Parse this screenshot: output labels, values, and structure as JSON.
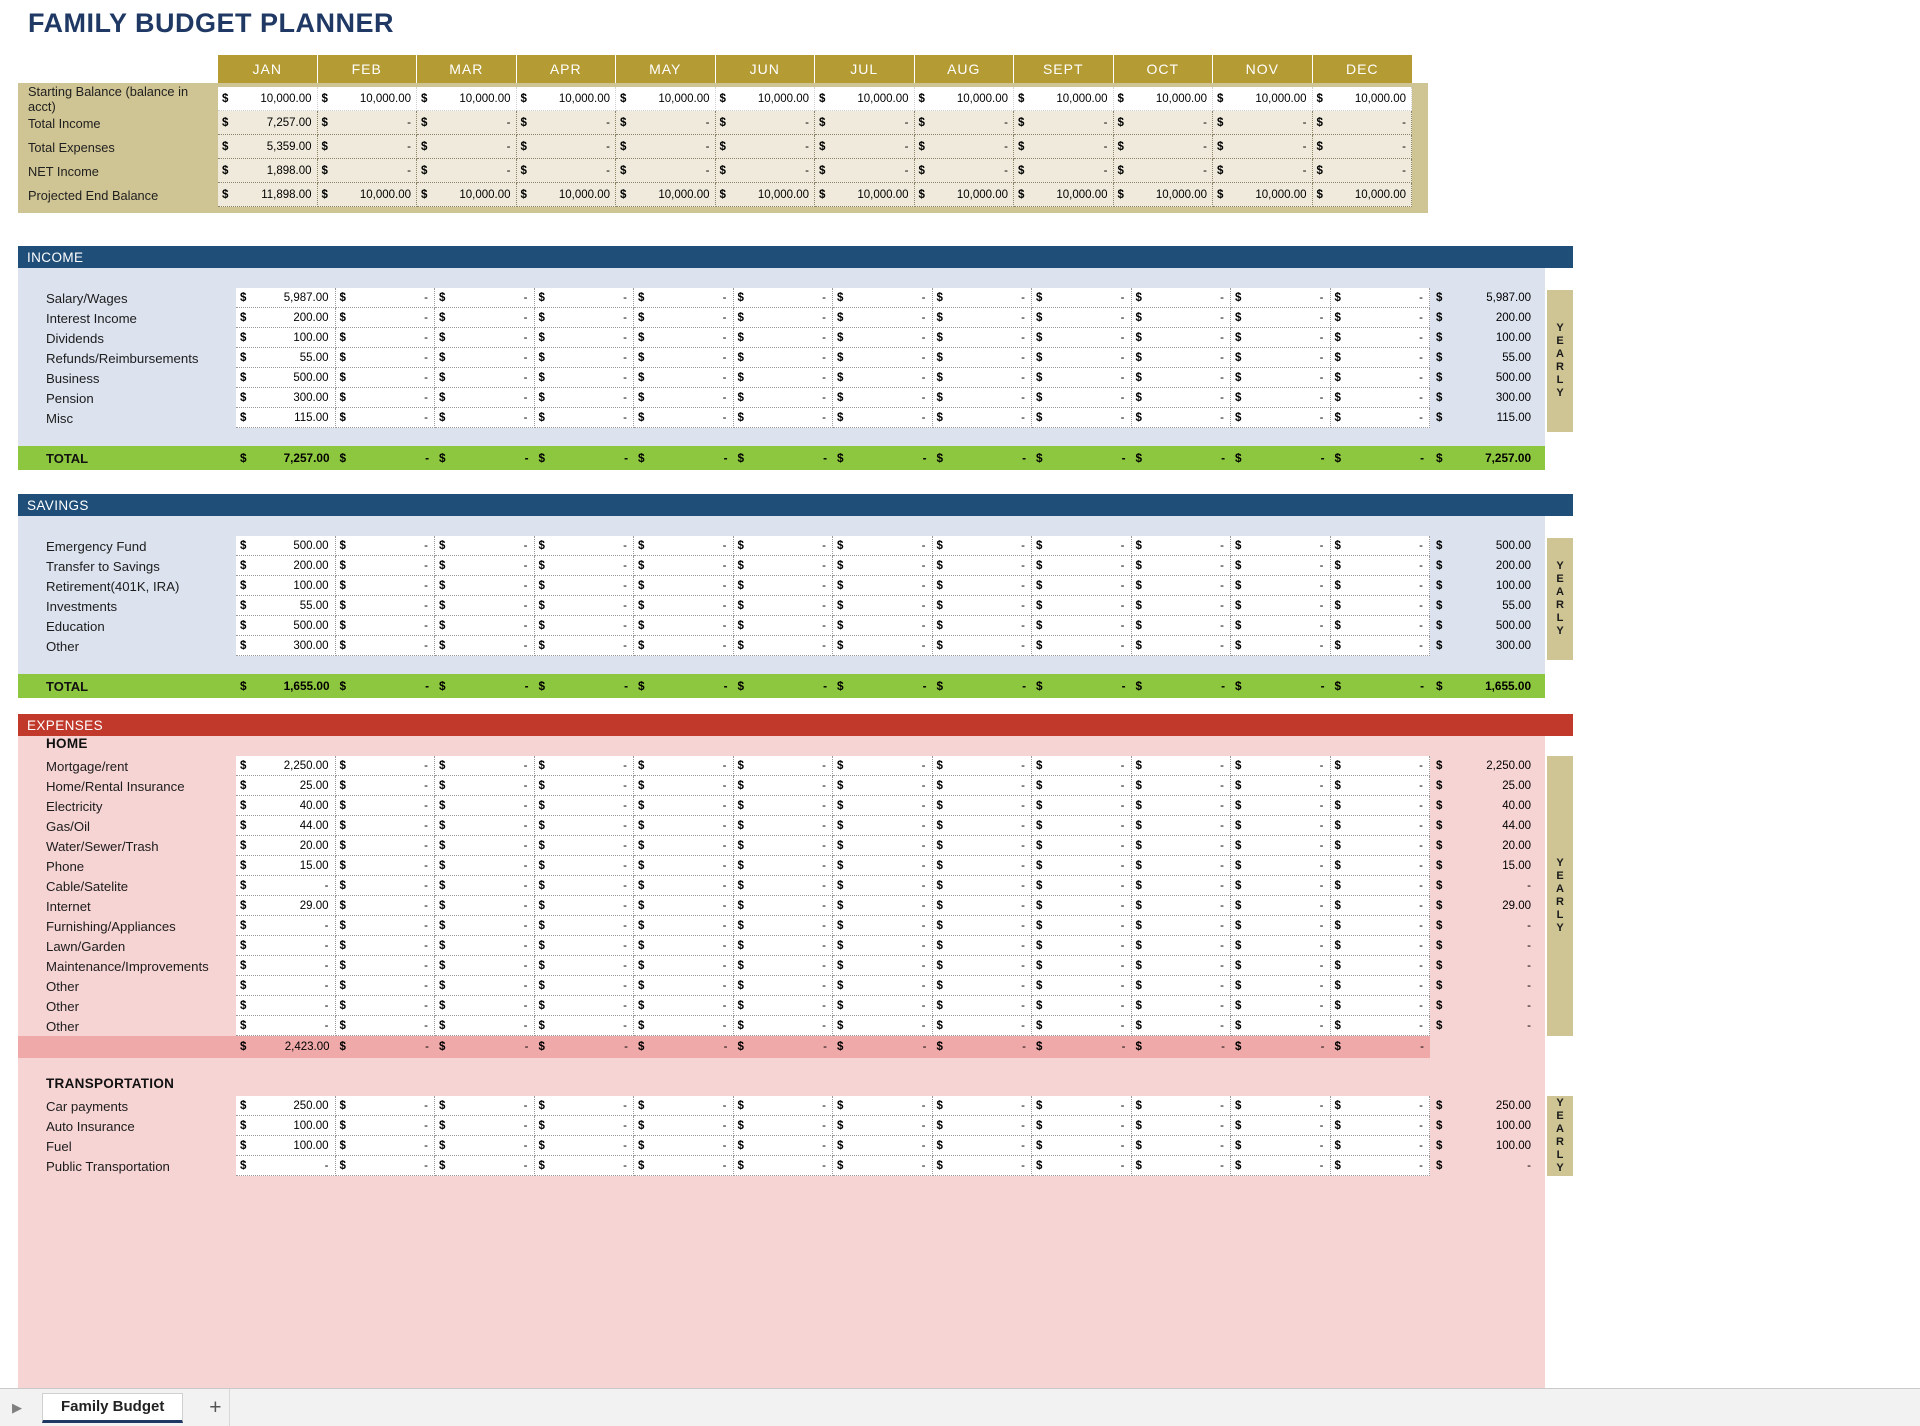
{
  "title": "FAMILY BUDGET PLANNER",
  "months": [
    "JAN",
    "FEB",
    "MAR",
    "APR",
    "MAY",
    "JUN",
    "JUL",
    "AUG",
    "SEPT",
    "OCT",
    "NOV",
    "DEC"
  ],
  "currency_symbol": "$",
  "blank_value": "-",
  "yearly_label": "YEARLY",
  "colors": {
    "title": "#1F3864",
    "month_header": "#B49B33",
    "summary_band": "#CFC493",
    "section_blue": "#1F4E79",
    "section_red": "#C0392B",
    "panel_blue": "#DCE3EF",
    "panel_red": "#F7D4D4",
    "total_green": "#8DC63F",
    "subtotal_pink": "#EFA9A9"
  },
  "summary": {
    "rows": [
      {
        "label": "Starting Balance (balance in acct)",
        "values": [
          "10,000.00",
          "10,000.00",
          "10,000.00",
          "10,000.00",
          "10,000.00",
          "10,000.00",
          "10,000.00",
          "10,000.00",
          "10,000.00",
          "10,000.00",
          "10,000.00",
          "10,000.00"
        ]
      },
      {
        "label": "Total Income",
        "values": [
          "7,257.00",
          "-",
          "-",
          "-",
          "-",
          "-",
          "-",
          "-",
          "-",
          "-",
          "-",
          "-"
        ]
      },
      {
        "label": "Total Expenses",
        "values": [
          "5,359.00",
          "-",
          "-",
          "-",
          "-",
          "-",
          "-",
          "-",
          "-",
          "-",
          "-",
          "-"
        ]
      },
      {
        "label": "NET Income",
        "values": [
          "1,898.00",
          "-",
          "-",
          "-",
          "-",
          "-",
          "-",
          "-",
          "-",
          "-",
          "-",
          "-"
        ]
      },
      {
        "label": "Projected End Balance",
        "values": [
          "11,898.00",
          "10,000.00",
          "10,000.00",
          "10,000.00",
          "10,000.00",
          "10,000.00",
          "10,000.00",
          "10,000.00",
          "10,000.00",
          "10,000.00",
          "10,000.00",
          "10,000.00"
        ]
      }
    ]
  },
  "income": {
    "section_label": "INCOME",
    "total_label": "TOTAL",
    "rows": [
      {
        "label": "Salary/Wages",
        "values": [
          "5,987.00",
          "-",
          "-",
          "-",
          "-",
          "-",
          "-",
          "-",
          "-",
          "-",
          "-",
          "-"
        ],
        "yearly": "5,987.00"
      },
      {
        "label": "Interest Income",
        "values": [
          "200.00",
          "-",
          "-",
          "-",
          "-",
          "-",
          "-",
          "-",
          "-",
          "-",
          "-",
          "-"
        ],
        "yearly": "200.00"
      },
      {
        "label": "Dividends",
        "values": [
          "100.00",
          "-",
          "-",
          "-",
          "-",
          "-",
          "-",
          "-",
          "-",
          "-",
          "-",
          "-"
        ],
        "yearly": "100.00"
      },
      {
        "label": "Refunds/Reimbursements",
        "values": [
          "55.00",
          "-",
          "-",
          "-",
          "-",
          "-",
          "-",
          "-",
          "-",
          "-",
          "-",
          "-"
        ],
        "yearly": "55.00"
      },
      {
        "label": "Business",
        "values": [
          "500.00",
          "-",
          "-",
          "-",
          "-",
          "-",
          "-",
          "-",
          "-",
          "-",
          "-",
          "-"
        ],
        "yearly": "500.00"
      },
      {
        "label": "Pension",
        "values": [
          "300.00",
          "-",
          "-",
          "-",
          "-",
          "-",
          "-",
          "-",
          "-",
          "-",
          "-",
          "-"
        ],
        "yearly": "300.00"
      },
      {
        "label": "Misc",
        "values": [
          "115.00",
          "-",
          "-",
          "-",
          "-",
          "-",
          "-",
          "-",
          "-",
          "-",
          "-",
          "-"
        ],
        "yearly": "115.00"
      }
    ],
    "total_values": [
      "7,257.00",
      "-",
      "-",
      "-",
      "-",
      "-",
      "-",
      "-",
      "-",
      "-",
      "-",
      "-"
    ],
    "total_yearly": "7,257.00"
  },
  "savings": {
    "section_label": "SAVINGS",
    "total_label": "TOTAL",
    "rows": [
      {
        "label": "Emergency Fund",
        "values": [
          "500.00",
          "-",
          "-",
          "-",
          "-",
          "-",
          "-",
          "-",
          "-",
          "-",
          "-",
          "-"
        ],
        "yearly": "500.00"
      },
      {
        "label": "Transfer to Savings",
        "values": [
          "200.00",
          "-",
          "-",
          "-",
          "-",
          "-",
          "-",
          "-",
          "-",
          "-",
          "-",
          "-"
        ],
        "yearly": "200.00"
      },
      {
        "label": "Retirement(401K, IRA)",
        "values": [
          "100.00",
          "-",
          "-",
          "-",
          "-",
          "-",
          "-",
          "-",
          "-",
          "-",
          "-",
          "-"
        ],
        "yearly": "100.00"
      },
      {
        "label": "Investments",
        "values": [
          "55.00",
          "-",
          "-",
          "-",
          "-",
          "-",
          "-",
          "-",
          "-",
          "-",
          "-",
          "-"
        ],
        "yearly": "55.00"
      },
      {
        "label": "Education",
        "values": [
          "500.00",
          "-",
          "-",
          "-",
          "-",
          "-",
          "-",
          "-",
          "-",
          "-",
          "-",
          "-"
        ],
        "yearly": "500.00"
      },
      {
        "label": "Other",
        "values": [
          "300.00",
          "-",
          "-",
          "-",
          "-",
          "-",
          "-",
          "-",
          "-",
          "-",
          "-",
          "-"
        ],
        "yearly": "300.00"
      }
    ],
    "total_values": [
      "1,655.00",
      "-",
      "-",
      "-",
      "-",
      "-",
      "-",
      "-",
      "-",
      "-",
      "-",
      "-"
    ],
    "total_yearly": "1,655.00"
  },
  "expenses": {
    "section_label": "EXPENSES",
    "groups": [
      {
        "name": "HOME",
        "rows": [
          {
            "label": "Mortgage/rent",
            "values": [
              "2,250.00",
              "-",
              "-",
              "-",
              "-",
              "-",
              "-",
              "-",
              "-",
              "-",
              "-",
              "-"
            ],
            "yearly": "2,250.00"
          },
          {
            "label": "Home/Rental Insurance",
            "values": [
              "25.00",
              "-",
              "-",
              "-",
              "-",
              "-",
              "-",
              "-",
              "-",
              "-",
              "-",
              "-"
            ],
            "yearly": "25.00"
          },
          {
            "label": "Electricity",
            "values": [
              "40.00",
              "-",
              "-",
              "-",
              "-",
              "-",
              "-",
              "-",
              "-",
              "-",
              "-",
              "-"
            ],
            "yearly": "40.00"
          },
          {
            "label": "Gas/Oil",
            "values": [
              "44.00",
              "-",
              "-",
              "-",
              "-",
              "-",
              "-",
              "-",
              "-",
              "-",
              "-",
              "-"
            ],
            "yearly": "44.00"
          },
          {
            "label": "Water/Sewer/Trash",
            "values": [
              "20.00",
              "-",
              "-",
              "-",
              "-",
              "-",
              "-",
              "-",
              "-",
              "-",
              "-",
              "-"
            ],
            "yearly": "20.00"
          },
          {
            "label": "Phone",
            "values": [
              "15.00",
              "-",
              "-",
              "-",
              "-",
              "-",
              "-",
              "-",
              "-",
              "-",
              "-",
              "-"
            ],
            "yearly": "15.00"
          },
          {
            "label": "Cable/Satelite",
            "values": [
              "-",
              "-",
              "-",
              "-",
              "-",
              "-",
              "-",
              "-",
              "-",
              "-",
              "-",
              "-"
            ],
            "yearly": "-"
          },
          {
            "label": "Internet",
            "values": [
              "29.00",
              "-",
              "-",
              "-",
              "-",
              "-",
              "-",
              "-",
              "-",
              "-",
              "-",
              "-"
            ],
            "yearly": "29.00"
          },
          {
            "label": "Furnishing/Appliances",
            "values": [
              "-",
              "-",
              "-",
              "-",
              "-",
              "-",
              "-",
              "-",
              "-",
              "-",
              "-",
              "-"
            ],
            "yearly": "-"
          },
          {
            "label": "Lawn/Garden",
            "values": [
              "-",
              "-",
              "-",
              "-",
              "-",
              "-",
              "-",
              "-",
              "-",
              "-",
              "-",
              "-"
            ],
            "yearly": "-"
          },
          {
            "label": "Maintenance/Improvements",
            "values": [
              "-",
              "-",
              "-",
              "-",
              "-",
              "-",
              "-",
              "-",
              "-",
              "-",
              "-",
              "-"
            ],
            "yearly": "-"
          },
          {
            "label": "Other",
            "values": [
              "-",
              "-",
              "-",
              "-",
              "-",
              "-",
              "-",
              "-",
              "-",
              "-",
              "-",
              "-"
            ],
            "yearly": "-"
          },
          {
            "label": "Other",
            "values": [
              "-",
              "-",
              "-",
              "-",
              "-",
              "-",
              "-",
              "-",
              "-",
              "-",
              "-",
              "-"
            ],
            "yearly": "-"
          },
          {
            "label": "Other",
            "values": [
              "-",
              "-",
              "-",
              "-",
              "-",
              "-",
              "-",
              "-",
              "-",
              "-",
              "-",
              "-"
            ],
            "yearly": "-"
          }
        ],
        "subtotal_values": [
          "2,423.00",
          "-",
          "-",
          "-",
          "-",
          "-",
          "-",
          "-",
          "-",
          "-",
          "-",
          "-"
        ]
      },
      {
        "name": "TRANSPORTATION",
        "rows": [
          {
            "label": "Car payments",
            "values": [
              "250.00",
              "-",
              "-",
              "-",
              "-",
              "-",
              "-",
              "-",
              "-",
              "-",
              "-",
              "-"
            ],
            "yearly": "250.00"
          },
          {
            "label": "Auto Insurance",
            "values": [
              "100.00",
              "-",
              "-",
              "-",
              "-",
              "-",
              "-",
              "-",
              "-",
              "-",
              "-",
              "-"
            ],
            "yearly": "100.00"
          },
          {
            "label": "Fuel",
            "values": [
              "100.00",
              "-",
              "-",
              "-",
              "-",
              "-",
              "-",
              "-",
              "-",
              "-",
              "-",
              "-"
            ],
            "yearly": "100.00"
          },
          {
            "label": "Public Transportation",
            "values": [
              "-",
              "-",
              "-",
              "-",
              "-",
              "-",
              "-",
              "-",
              "-",
              "-",
              "-",
              "-"
            ],
            "yearly": "-"
          }
        ]
      }
    ]
  },
  "tabbar": {
    "scroll_icon": "▶",
    "active_tab": "Family Budget",
    "add_sheet": "+"
  }
}
